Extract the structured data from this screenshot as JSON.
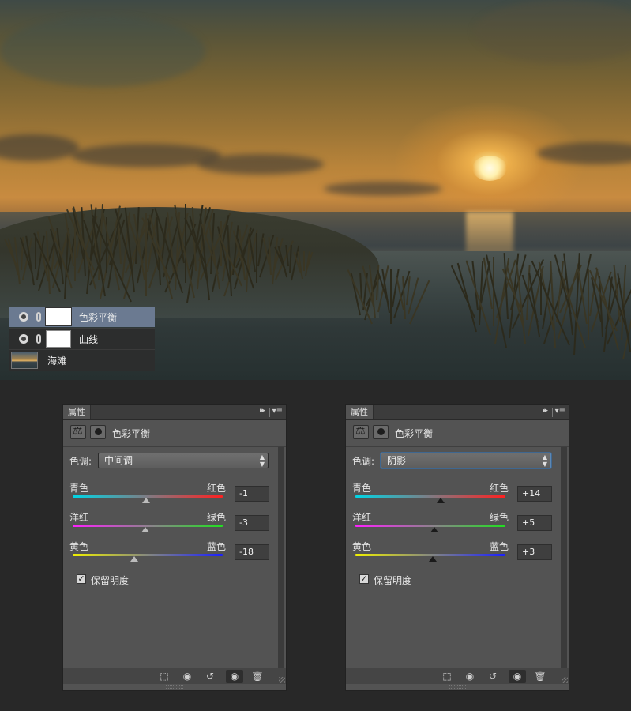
{
  "layers": [
    {
      "name": "色彩平衡",
      "selected": true,
      "icon": "adjustment-eye-icon"
    },
    {
      "name": "曲线",
      "selected": false,
      "icon": "adjustment-eye-icon"
    },
    {
      "name": "海滩",
      "selected": false,
      "icon": "image-thumbnail"
    }
  ],
  "panels": [
    {
      "tab": "属性",
      "title": "色彩平衡",
      "tone_label": "色调:",
      "tone_value": "中间调",
      "sliders": [
        {
          "left": "青色",
          "right": "红色",
          "value": "-1",
          "fraction": 0.49
        },
        {
          "left": "洋红",
          "right": "绿色",
          "value": "-3",
          "fraction": 0.485
        },
        {
          "left": "黄色",
          "right": "蓝色",
          "value": "-18",
          "fraction": 0.41
        }
      ],
      "checkbox_label": "保留明度",
      "checkbox_checked": true
    },
    {
      "tab": "属性",
      "title": "色彩平衡",
      "tone_label": "色调:",
      "tone_value": "阴影",
      "sliders": [
        {
          "left": "青色",
          "right": "红色",
          "value": "+14",
          "fraction": 0.57
        },
        {
          "left": "洋红",
          "right": "绿色",
          "value": "+5",
          "fraction": 0.525
        },
        {
          "left": "黄色",
          "right": "蓝色",
          "value": "+3",
          "fraction": 0.515
        }
      ],
      "checkbox_label": "保留明度",
      "checkbox_checked": true
    }
  ],
  "icons": {
    "collapse": "▸▸",
    "menu": "▾≡",
    "checkmark": "✓",
    "bottom_bar": [
      "clip-to-layer-icon",
      "view-previous-state-icon",
      "reset-icon",
      "visibility-eye-icon",
      "trash-icon"
    ],
    "bottom_bar_glyphs": [
      "⬚",
      "◉",
      "↺",
      "◉",
      "🗑"
    ]
  },
  "colors": {
    "panel_bg": "#535353",
    "selected_layer": "#6b7a91",
    "focus_ring": "#5d88b5"
  }
}
